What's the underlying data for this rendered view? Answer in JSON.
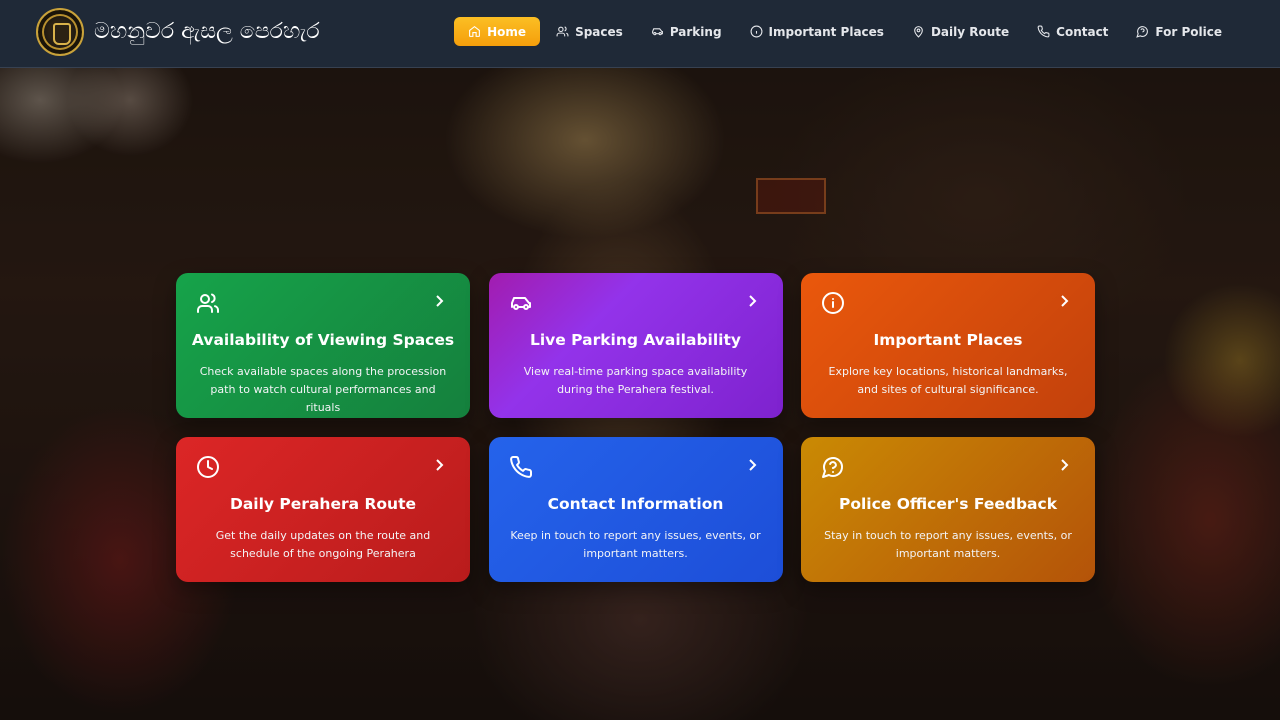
{
  "header": {
    "title": "මහනුවර ඇසල පෙරහැර",
    "logo": "kandy-municipal-seal"
  },
  "nav": [
    {
      "label": "Home",
      "icon": "home-icon",
      "active": true
    },
    {
      "label": "Spaces",
      "icon": "users-icon",
      "active": false
    },
    {
      "label": "Parking",
      "icon": "car-icon",
      "active": false
    },
    {
      "label": "Important Places",
      "icon": "info-icon",
      "active": false
    },
    {
      "label": "Daily Route",
      "icon": "map-pin-icon",
      "active": false
    },
    {
      "label": "Contact",
      "icon": "phone-icon",
      "active": false
    },
    {
      "label": "For Police",
      "icon": "help-chat-icon",
      "active": false
    }
  ],
  "cards": [
    {
      "title": "Availability of Viewing Spaces",
      "description": "Check available spaces along the procession path to watch cultural performances and rituals",
      "icon": "users-icon",
      "color": "#16a34a"
    },
    {
      "title": "Live Parking Availability",
      "description": "View real-time parking space availability during the Perahera festival.",
      "icon": "car-icon",
      "color": "#9333ea"
    },
    {
      "title": "Important Places",
      "description": "Explore key locations, historical landmarks, and sites of cultural significance.",
      "icon": "info-icon",
      "color": "#ea580c"
    },
    {
      "title": "Daily Perahera Route",
      "description": "Get the daily updates on the route and schedule of the ongoing Perahera",
      "icon": "clock-icon",
      "color": "#dc2626"
    },
    {
      "title": "Contact Information",
      "description": "Keep in touch to report any issues, events, or important matters.",
      "icon": "phone-icon",
      "color": "#2563eb"
    },
    {
      "title": "Police Officer's Feedback",
      "description": "Stay in touch to report any issues, events, or important matters.",
      "icon": "help-chat-icon",
      "color": "#ca8a04"
    }
  ],
  "colors": {
    "header_bg": "#1f2937",
    "active_nav": "#f59e0b"
  }
}
